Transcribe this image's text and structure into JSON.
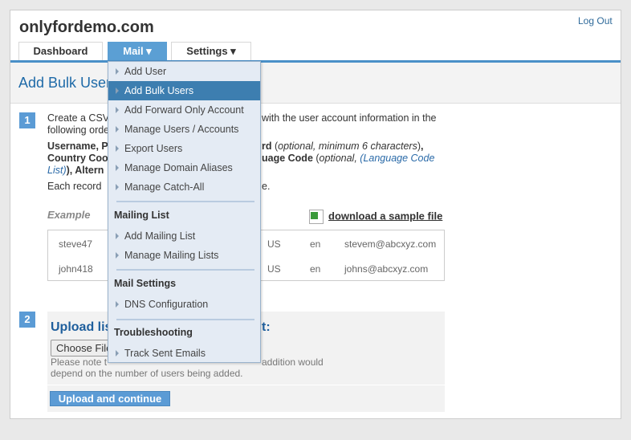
{
  "header": {
    "site_title": "onlyfordemo.com",
    "logout": "Log Out"
  },
  "tabs": [
    {
      "label": "Dashboard"
    },
    {
      "label": "Mail ▾"
    },
    {
      "label": "Settings ▾"
    }
  ],
  "page_title": "Add Bulk Users",
  "step1": {
    "number": "1",
    "line1_left": "Create a CSV",
    "line1_right": "with the user account information in the",
    "line2_left": "following orde",
    "line3_left": "Username, P",
    "line3_right_bold": "rd",
    "line3_right_italic": "optional, minimum 6 characters",
    "line4_left": "Country Coo",
    "line4_right_bold": "uage Code",
    "line4_right_italic": "optional, ",
    "line4_link": "(Language Code",
    "line5_link": "List)",
    "line5_rest": "), Altern",
    "line6_left": "Each record",
    "line6_right": "e.",
    "example_label": "Example",
    "download_link": "download a sample file",
    "rows": [
      {
        "user": "steve47",
        "country": "US",
        "lang": "en",
        "email": "stevem@abcxyz.com"
      },
      {
        "user": "john418",
        "country": "US",
        "lang": "en",
        "email": "johns@abcxyz.com"
      }
    ]
  },
  "step2": {
    "number": "2",
    "heading_left": "Upload lis",
    "heading_right": "t:",
    "choose_file": "Choose File",
    "note_left1": "Please note t",
    "note_right1": "addition would",
    "note2": "depend on the number of users being added.",
    "upload_button": "Upload and continue"
  },
  "mail_menu": {
    "items1": [
      "Add User",
      "Add Bulk Users",
      "Add Forward Only Account",
      "Manage Users / Accounts",
      "Export Users",
      "Manage Domain Aliases",
      "Manage Catch-All"
    ],
    "active_item": "Add Bulk Users",
    "mailing_list_header": "Mailing List",
    "items2": [
      "Add Mailing List",
      "Manage Mailing Lists"
    ],
    "mail_settings_header": "Mail Settings",
    "items3": [
      "DNS Configuration"
    ],
    "troubleshooting_header": "Troubleshooting",
    "items4": [
      "Track Sent Emails"
    ]
  },
  "colors": {
    "accent": "#5b9fd4",
    "menu_highlight": "#3d7eb0",
    "title_blue": "#1e6aa8"
  }
}
